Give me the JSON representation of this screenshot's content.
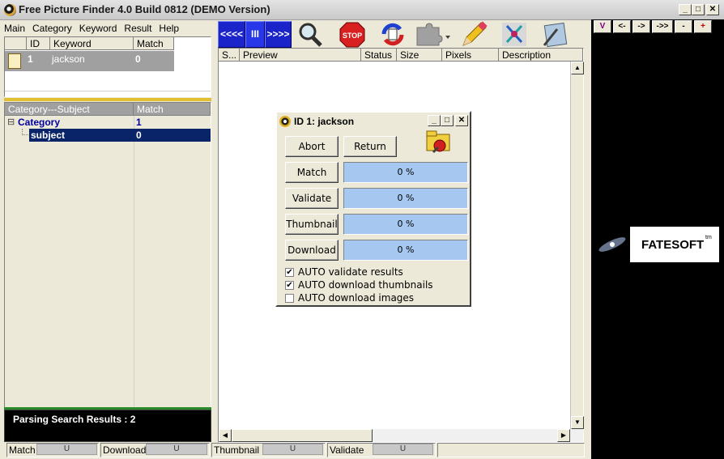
{
  "window": {
    "title": "Free Picture Finder 4.0 Build 0812  (DEMO Version)",
    "min_btn": "_",
    "max_btn": "□",
    "close_btn": "✕"
  },
  "menu": [
    "Main",
    "Category",
    "Keyword",
    "Result",
    "Help"
  ],
  "keyword_grid": {
    "headers": [
      "",
      "ID",
      "Keyword",
      "Match"
    ],
    "rows": [
      {
        "id": "1",
        "keyword": "jackson",
        "match": "0"
      }
    ]
  },
  "category_grid": {
    "headers": [
      "Category---Subject",
      "Match"
    ],
    "rows": [
      {
        "label": "Category",
        "match": "1",
        "expander": "⊟"
      },
      {
        "label": "subject",
        "match": "0"
      }
    ]
  },
  "status_message": "Parsing Search Results : 2",
  "navigation": {
    "prev": "<<<<",
    "pause": "III",
    "next": ">>>>"
  },
  "toolbar_icons": [
    "search-icon",
    "stop-icon",
    "refresh-icon",
    "puzzle-icon",
    "pencil-icon",
    "network-icon",
    "tools-icon"
  ],
  "toolbar": {
    "stop_label": "STOP"
  },
  "results_grid": {
    "headers": [
      "S...",
      "Preview",
      "Status",
      "Size",
      "Pixels",
      "Description"
    ]
  },
  "dialog": {
    "title": "ID 1: jackson",
    "abort": "Abort",
    "return": "Return",
    "rows": [
      {
        "label": "Match",
        "value": "0 %",
        "progress": 0
      },
      {
        "label": "Validate",
        "value": "0 %",
        "progress": 0
      },
      {
        "label": "Thumbnail",
        "value": "0 %",
        "progress": 0
      },
      {
        "label": "Download",
        "value": "0 %",
        "progress": 0
      }
    ],
    "options": [
      {
        "label": "AUTO validate results",
        "checked": true
      },
      {
        "label": "AUTO download thumbnails",
        "checked": true
      },
      {
        "label": "AUTO download images",
        "checked": false
      }
    ]
  },
  "right_panel": {
    "buttons": [
      "V",
      "<-",
      "->",
      "->>",
      "-",
      "+"
    ],
    "brand": "FATESOFT",
    "brand_sup": "tm"
  },
  "statusbar": [
    {
      "label": "Match",
      "bar": "U"
    },
    {
      "label": "Download",
      "bar": "U"
    },
    {
      "label": "Thumbnail",
      "bar": "U"
    },
    {
      "label": "Validate",
      "bar": "U"
    }
  ]
}
